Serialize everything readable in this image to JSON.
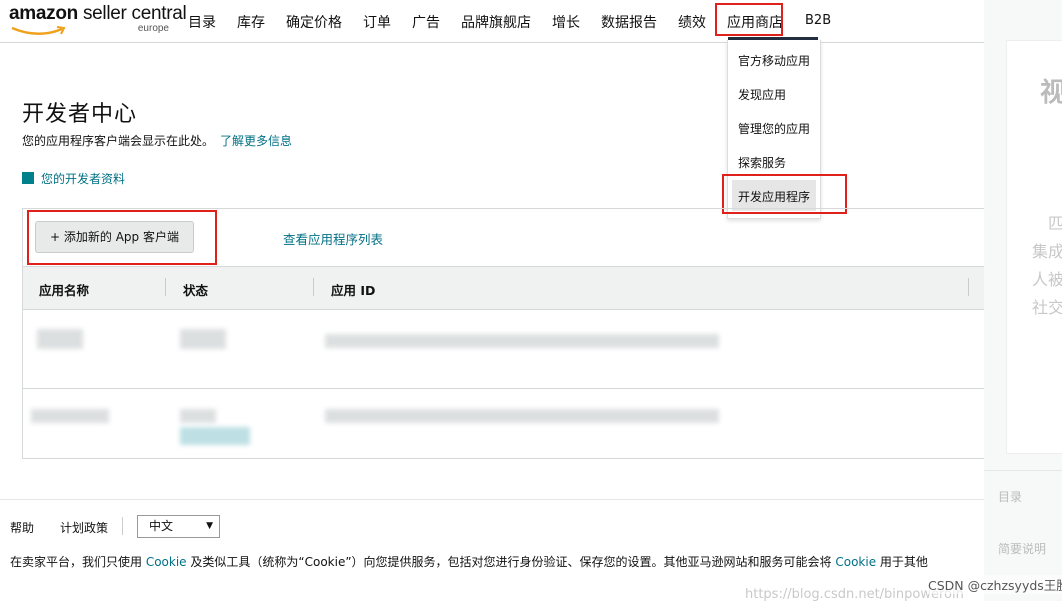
{
  "header": {
    "logo": {
      "brand": "amazon",
      "product": "seller central",
      "region": "europe"
    },
    "nav": [
      "目录",
      "库存",
      "确定价格",
      "订单",
      "广告",
      "品牌旗舰店",
      "增长",
      "数据报告",
      "绩效",
      "应用商店",
      "B2B"
    ],
    "active_nav": "应用商店"
  },
  "dropdown": {
    "items": [
      "官方移动应用",
      "发现应用",
      "管理您的应用",
      "探索服务",
      "开发应用程序"
    ],
    "highlighted": "开发应用程序"
  },
  "page": {
    "title": "开发者中心",
    "subtitle": "您的应用程序客户端会显示在此处。",
    "learn_more": "了解更多信息",
    "profile_link": "您的开发者资料"
  },
  "panel": {
    "add_button": "+ 添加新的 App 客户端",
    "view_list": "查看应用程序列表",
    "columns": [
      "应用名称",
      "状态",
      "应用 ID"
    ]
  },
  "footer": {
    "help": "帮助",
    "policies": "计划政策",
    "language": "中文",
    "cookie_prefix": "在卖家平台，我们只使用 ",
    "cookie_word1": "Cookie",
    "cookie_mid": " 及类似工具（统称为“Cookie”）向您提供服务，包括对您进行身份验证、保存您的设置。其他亚马逊网站和服务可能会将 ",
    "cookie_word2": "Cookie",
    "cookie_suffix": " 用于其他"
  },
  "right_side": {
    "big": "视",
    "lines": [
      "匹",
      "集成",
      "人被",
      "社交"
    ],
    "menu": [
      "目录",
      "简要说明"
    ]
  },
  "overlays": {
    "watermark": "https://blog.csdn.net/binpoweroin",
    "csdn": "CSDN @czhzsyyds王胜"
  },
  "colors": {
    "accent_link": "#007185",
    "highlight_red": "#e0201b",
    "nav_underline": "#232f3e"
  }
}
